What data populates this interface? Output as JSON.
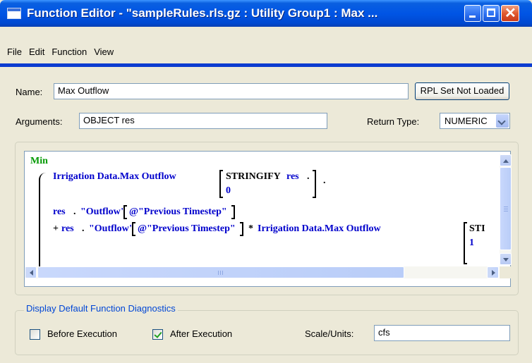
{
  "window": {
    "title": "Function Editor - \"sampleRules.rls.gz : Utility Group1 : Max ...",
    "icons": {
      "minimize": "minimize-icon",
      "maximize": "maximize-icon",
      "close": "close-icon"
    }
  },
  "menu": [
    "File",
    "Edit",
    "Function",
    "View"
  ],
  "form": {
    "name_label": "Name:",
    "name_value": "Max Outflow",
    "rpl_button": "RPL Set Not Loaded",
    "arguments_label": "Arguments:",
    "arguments_value": "OBJECT res",
    "return_type_label": "Return Type:",
    "return_type_value": "NUMERIC"
  },
  "code": {
    "min": "Min",
    "line1_object": "Irrigation Data.Max Outflow",
    "line1_stringify": "STRINGIFY",
    "line1_res": "res",
    "line1_dot": ".",
    "line1_zero": "0",
    "line1_trail": ".",
    "line2_res": "res",
    "line2_dot": ".",
    "line2_outflow": "\"Outflow\"",
    "line2_timestep": "@\"Previous Timestep\"",
    "line3_plus": "+",
    "line3_res": "res",
    "line3_dot": ".",
    "line3_outflow": "\"Outflow\"",
    "line3_timestep": "@\"Previous Timestep\"",
    "line3_times": "*",
    "line3_object": "Irrigation Data.Max Outflow",
    "line3_st": "STI",
    "line3_one": "1"
  },
  "diagnostics": {
    "legend": "Display Default Function Diagnostics",
    "before_label": "Before Execution",
    "before_checked": false,
    "after_label": "After Execution",
    "after_checked": true,
    "scale_label": "Scale/Units:",
    "scale_value": "cfs"
  },
  "colors": {
    "title_bar": "#0055e5",
    "accent_line": "#0b3cd0",
    "code_text": "#0000cc",
    "min_keyword": "#009900"
  }
}
